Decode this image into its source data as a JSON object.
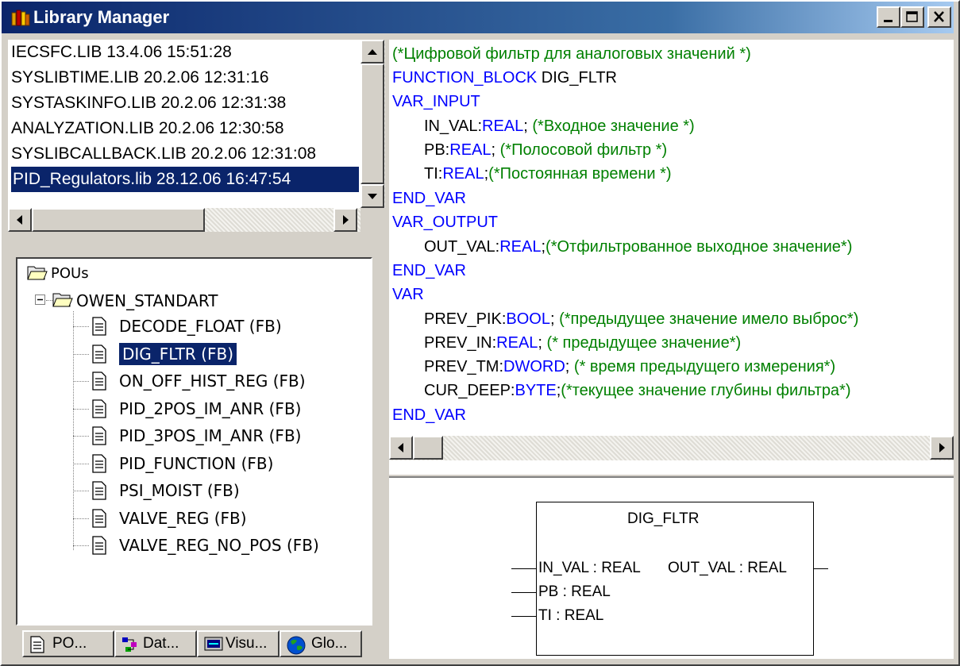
{
  "window": {
    "title": "Library Manager",
    "minimize_icon": "minimize-icon",
    "maximize_icon": "maximize-icon",
    "close_icon": "close-icon"
  },
  "libraries": [
    {
      "label": "IECSFC.LIB 13.4.06 15:51:28",
      "selected": false
    },
    {
      "label": "SYSLIBTIME.LIB 20.2.06 12:31:16",
      "selected": false
    },
    {
      "label": "SYSTASKINFO.LIB 20.2.06 12:31:38",
      "selected": false
    },
    {
      "label": "ANALYZATION.LIB 20.2.06 12:30:58",
      "selected": false
    },
    {
      "label": "SYSLIBCALLBACK.LIB 20.2.06 12:31:08",
      "selected": false
    },
    {
      "label": "PID_Regulators.lib 28.12.06 16:47:54",
      "selected": true
    }
  ],
  "tree": {
    "root": "POUs",
    "folder": "OWEN_STANDART",
    "items": [
      {
        "label": "DECODE_FLOAT (FB)",
        "selected": false
      },
      {
        "label": "DIG_FLTR (FB)",
        "selected": true
      },
      {
        "label": "ON_OFF_HIST_REG (FB)",
        "selected": false
      },
      {
        "label": "PID_2POS_IM_ANR (FB)",
        "selected": false
      },
      {
        "label": "PID_3POS_IM_ANR (FB)",
        "selected": false
      },
      {
        "label": "PID_FUNCTION (FB)",
        "selected": false
      },
      {
        "label": "PSI_MOIST (FB)",
        "selected": false
      },
      {
        "label": "VALVE_REG (FB)",
        "selected": false
      },
      {
        "label": "VALVE_REG_NO_POS (FB)",
        "selected": false
      }
    ]
  },
  "tabs": [
    {
      "label": "PO...",
      "icon": "document-icon"
    },
    {
      "label": "Dat...",
      "icon": "datatypes-icon"
    },
    {
      "label": "Visu...",
      "icon": "visualization-icon"
    },
    {
      "label": "Glo...",
      "icon": "globe-icon"
    }
  ],
  "code": {
    "l1": "(*Цифровой фильтр для аналоговых значений *)",
    "l2_kw": "FUNCTION_BLOCK",
    "l2_id": " DIG_FLTR",
    "l3": "VAR_INPUT",
    "l4_id": "IN_VAL:",
    "l4_kw": "REAL",
    "l4_sep": "; ",
    "l4_cm": "(*Входное значение *)",
    "l5_id": "PB:",
    "l5_kw": "REAL",
    "l5_sep": "; ",
    "l5_cm": "(*Полосовой фильтр *)",
    "l6_id": "TI:",
    "l6_kw": "REAL",
    "l6_sep": ";",
    "l6_cm": "(*Постоянная времени *)",
    "l7": "END_VAR",
    "l8": "VAR_OUTPUT",
    "l9_id": "OUT_VAL:",
    "l9_kw": "REAL",
    "l9_sep": ";",
    "l9_cm": "(*Отфильтрованное выходное значение*)",
    "l10": "END_VAR",
    "l11": "VAR",
    "l12_id": "PREV_PIK:",
    "l12_kw": "BOOL",
    "l12_sep": "; ",
    "l12_cm": "(*предыдущее значение имело выброс*)",
    "l13_id": "PREV_IN:",
    "l13_kw": "REAL",
    "l13_sep": "; ",
    "l13_cm": "(* предыдущее значение*)",
    "l14_id": "PREV_TM:",
    "l14_kw": "DWORD",
    "l14_sep": "; ",
    "l14_cm": "(* время предыдущего измерения*)",
    "l15_id": "CUR_DEEP:",
    "l15_kw": "BYTE",
    "l15_sep": ";",
    "l15_cm": "(*текущее значение глубины фильтра*)",
    "l16": "END_VAR"
  },
  "block": {
    "name": "DIG_FLTR",
    "in1": "IN_VAL : REAL",
    "out1": "OUT_VAL : REAL",
    "in2": "PB : REAL",
    "in3": "TI : REAL"
  },
  "colors": {
    "comment": "#008000",
    "keyword": "#0000ff",
    "selection": "#0a246a"
  }
}
